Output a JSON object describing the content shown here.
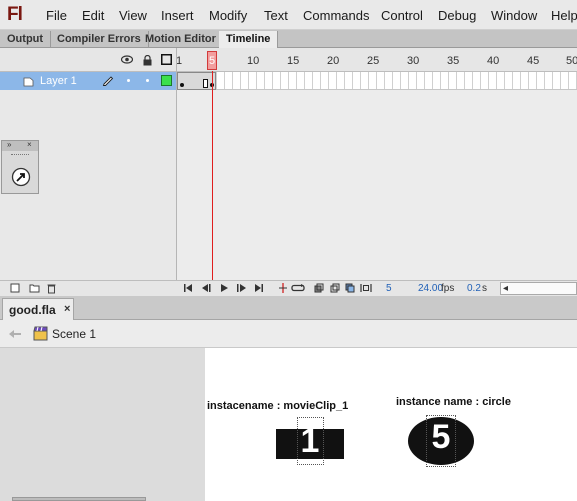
{
  "app": {
    "logo": "Fl"
  },
  "menu": [
    "File",
    "Edit",
    "View",
    "Insert",
    "Modify",
    "Text",
    "Commands",
    "Control",
    "Debug",
    "Window",
    "Help"
  ],
  "panel_tabs": [
    "Output",
    "Compiler Errors",
    "Motion Editor",
    "Timeline"
  ],
  "timeline": {
    "frame_numbers": [
      "1",
      "5",
      "10",
      "15",
      "20",
      "25",
      "30",
      "35",
      "40",
      "45",
      "50"
    ],
    "layer_name": "Layer 1",
    "current_frame": "5",
    "fps": "24.00",
    "fps_unit": "fps",
    "elapsed": "0.2",
    "elapsed_unit": "s"
  },
  "document": {
    "tab_label": "good.fla",
    "close_glyph": "×",
    "scene": "Scene 1"
  },
  "stage": {
    "movieclip_label": "instacename : movieClip_1",
    "movieclip_digit": "1",
    "circle_label": "instance name : circle",
    "circle_digit": "5"
  },
  "icons": {
    "eye": "eye-icon",
    "lock": "lock-icon",
    "outline": "outline-icon",
    "pencil": "pencil-icon",
    "play": "play-icon",
    "scene": "clapboard-icon"
  },
  "colors": {
    "layer_highlight": "#8cb7e8",
    "playhead": "#e01e1e",
    "logo": "#7a1710",
    "link_blue": "#2161b7"
  }
}
